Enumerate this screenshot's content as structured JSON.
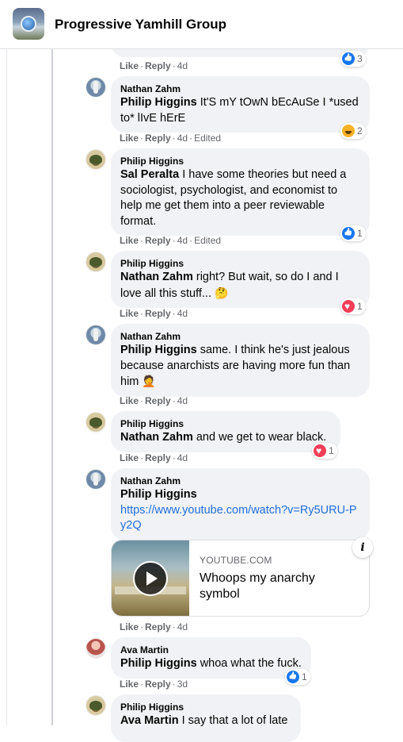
{
  "header": {
    "group_name": "Progressive Yamhill Group"
  },
  "actions": {
    "like": "Like",
    "reply": "Reply",
    "dot": "·",
    "edited": "Edited"
  },
  "comments": [
    {
      "time": "4d",
      "reaction": {
        "type": "like",
        "count": "3"
      }
    },
    {
      "author": "Nathan Zahm",
      "mention": "Philip Higgins",
      "text": " It'S mY tOwN bEcAuSe I *used to* lIvE hErE",
      "time": "4d",
      "edited": true,
      "reaction": {
        "type": "haha",
        "count": "2"
      }
    },
    {
      "author": "Philip Higgins",
      "mention": "Sal Peralta",
      "text": " I have some theories but need a sociologist, psychologist, and economist to help me get them into a peer reviewable format.",
      "time": "4d",
      "edited": true,
      "reaction": {
        "type": "like",
        "count": "1"
      }
    },
    {
      "author": "Philip Higgins",
      "mention": "Nathan Zahm",
      "text": " right? But wait, so do I and I love all this stuff... ",
      "emoji": "🤔",
      "time": "4d",
      "reaction": {
        "type": "love",
        "count": "1"
      }
    },
    {
      "author": "Nathan Zahm",
      "mention": "Philip Higgins",
      "text": " same. I think he's just jealous because anarchists are having more fun than him ",
      "emoji": "🤦",
      "time": "4d"
    },
    {
      "author": "Philip Higgins",
      "mention": "Nathan Zahm",
      "text": " and we get to wear black.",
      "time": "4d",
      "reaction": {
        "type": "love",
        "count": "1"
      }
    },
    {
      "author": "Nathan Zahm",
      "mention": "Philip Higgins",
      "link": "https://www.youtube.com/watch?v=Ry5URU-Py2Q",
      "time": "4d",
      "preview": {
        "domain": "YOUTUBE.COM",
        "title": "Whoops my anarchy symbol"
      }
    },
    {
      "author": "Ava Martin",
      "mention": "Philip Higgins",
      "text": " whoa what the fuck.",
      "time": "3d",
      "reaction": {
        "type": "like",
        "count": "1"
      }
    },
    {
      "author": "Philip Higgins",
      "mention": "Ava Martin",
      "text": " I say that a lot of late"
    }
  ]
}
